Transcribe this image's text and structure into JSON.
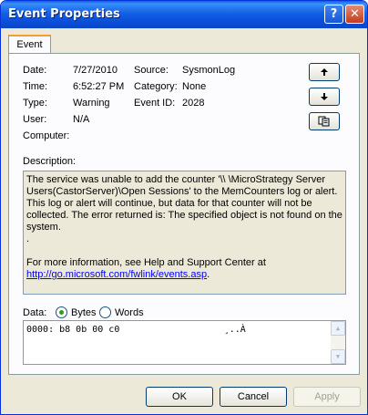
{
  "window": {
    "title": "Event Properties",
    "help_glyph": "?",
    "close_glyph": "✕"
  },
  "tabs": [
    {
      "label": "Event",
      "active": true
    }
  ],
  "fields": {
    "date_label": "Date:",
    "date_value": "7/27/2010",
    "source_label": "Source:",
    "source_value": "SysmonLog",
    "time_label": "Time:",
    "time_value": "6:52:27 PM",
    "category_label": "Category:",
    "category_value": "None",
    "type_label": "Type:",
    "type_value": "Warning",
    "event_id_label": "Event ID:",
    "event_id_value": "2028",
    "user_label": "User:",
    "user_value": "N/A",
    "computer_label": "Computer:",
    "computer_value": ""
  },
  "nav_buttons": {
    "up_icon": "arrow-up-icon",
    "down_icon": "arrow-down-icon",
    "copy_icon": "copy-icon"
  },
  "description": {
    "label": "Description:",
    "text": "The service was unable to add the counter '\\\\ \\MicroStrategy Server Users(CastorServer)\\Open Sessions' to the MemCounters log or alert.  This log or alert will continue, but data for that counter will not be collected. The error returned is: The specified object is not found on the system.",
    "dot": ".",
    "more_info": "For more information, see Help and Support Center at",
    "link": "http://go.microsoft.com/fwlink/events.asp",
    "link_tail": "."
  },
  "data_section": {
    "label": "Data:",
    "format_options": [
      "Bytes",
      "Words"
    ],
    "selected_format": "Bytes",
    "line": "0000: b8 0b 00 c0                   ¸..À"
  },
  "buttons": {
    "ok": "OK",
    "cancel": "Cancel",
    "apply": "Apply",
    "apply_enabled": false
  },
  "colors": {
    "title_bar": "#0a4fd8",
    "dialog_bg": "#ece9d8",
    "tab_accent": "#f1a02e",
    "link": "#0000ff"
  }
}
